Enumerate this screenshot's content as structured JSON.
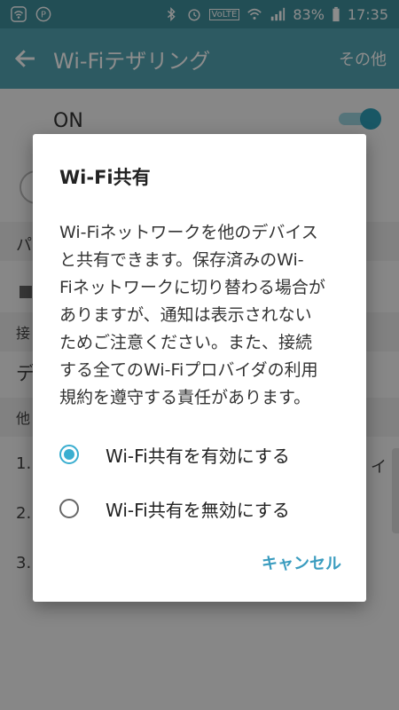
{
  "status_bar": {
    "volte": "VoLTE",
    "battery": "83%",
    "time": "17:35"
  },
  "app_bar": {
    "title": "Wi-Fiテザリング",
    "more": "その他"
  },
  "background": {
    "on_label": "ON",
    "frags": [
      "パ",
      "接",
      "デ",
      "他",
      "1.",
      "2.",
      "3.",
      "イ"
    ]
  },
  "dialog": {
    "title": "Wi-Fi共有",
    "message_lines": [
      "Wi-Fiネットワークを他のデバイス",
      "と共有できます。保存済みのWi-",
      "Fiネットワークに切り替わる場合が",
      "ありますが、通知は表示されない",
      "ためご注意ください。また、接続",
      "する全てのWi-Fiプロバイダの利用",
      "規約を遵守する責任があります。"
    ],
    "option_enable": "Wi-Fi共有を有効にする",
    "option_disable": "Wi-Fi共有を無効にする",
    "selected": "enable",
    "cancel": "キャンセル"
  },
  "colors": {
    "status_bar": "#3f8f9c",
    "app_bar": "#53a5b3",
    "accent": "#3aaed0"
  }
}
